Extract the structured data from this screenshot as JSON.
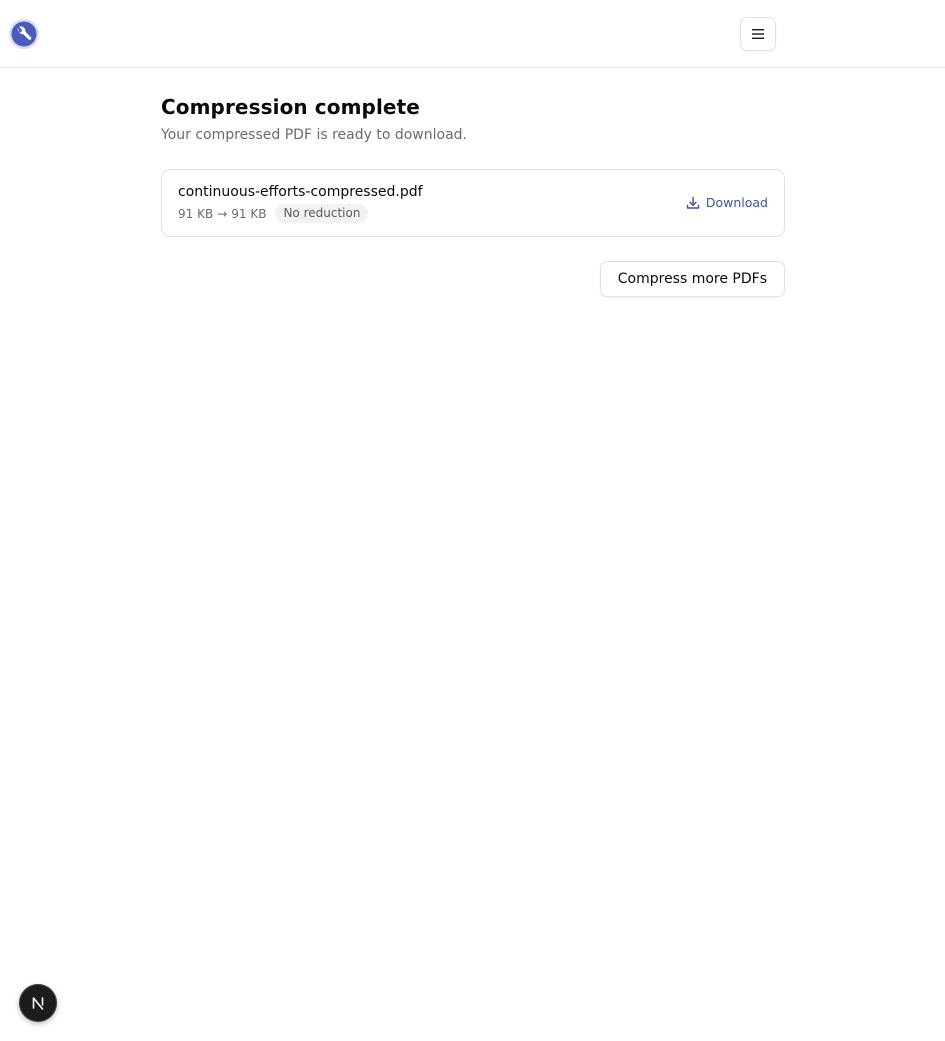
{
  "header": {
    "logo_icon": "wrench-logo-icon",
    "menu_icon": "hamburger-menu-icon"
  },
  "main": {
    "title": "Compression complete",
    "subtitle": "Your compressed PDF is ready to download."
  },
  "file": {
    "name": "continuous-efforts-compressed.pdf",
    "size_before": "91 KB",
    "arrow": "→",
    "size_after": "91 KB",
    "badge": "No reduction",
    "download_label": "Download",
    "download_icon": "download-icon"
  },
  "actions": {
    "compress_more_label": "Compress more PDFs"
  },
  "dev_indicator": {
    "icon": "nextjs-icon"
  },
  "colors": {
    "accent": "#3f4fb5",
    "logo_blue": "#4a5bbf",
    "border": "#e2e2e2",
    "muted_text": "#6b6b6b"
  }
}
